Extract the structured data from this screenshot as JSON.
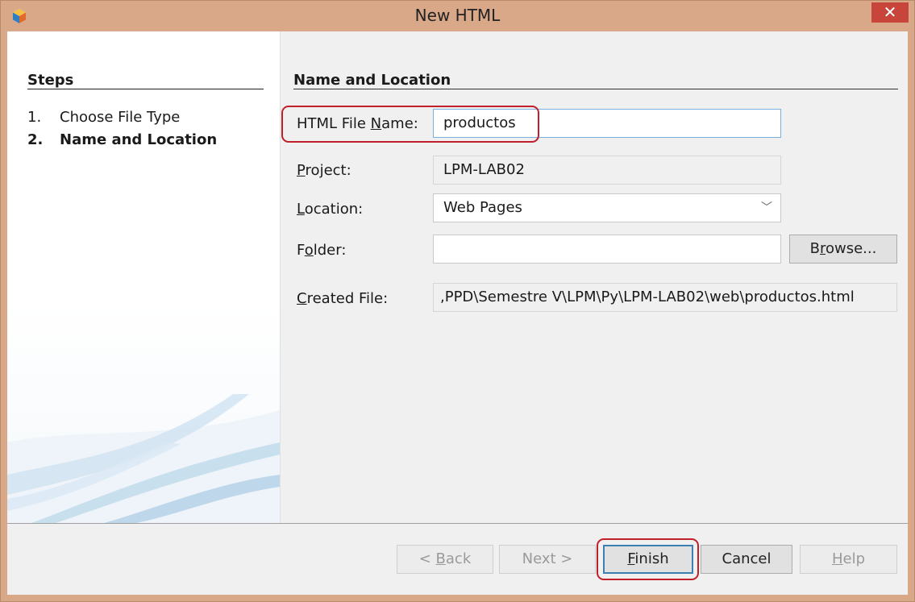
{
  "window": {
    "title": "New HTML",
    "close_glyph": "✕"
  },
  "steps": {
    "heading": "Steps",
    "items": [
      {
        "number": "1.",
        "label": "Choose File Type"
      },
      {
        "number": "2.",
        "label": "Name and Location"
      }
    ]
  },
  "main": {
    "heading": "Name and Location",
    "html_file_name": {
      "label_pre": "HTML File ",
      "label_mnemonic": "N",
      "label_post": "ame:",
      "value": "productos"
    },
    "project": {
      "label_mnemonic": "P",
      "label_post": "roject:",
      "value": "LPM-LAB02"
    },
    "location": {
      "label_mnemonic": "L",
      "label_post": "ocation:",
      "value": "Web Pages"
    },
    "folder": {
      "label_pre": "F",
      "label_mnemonic": "o",
      "label_post": "lder:",
      "value": ""
    },
    "browse": {
      "pre": "B",
      "mnemonic": "r",
      "post": "owse..."
    },
    "created_file": {
      "label_mnemonic": "C",
      "label_post": "reated File:",
      "value": ",PPD\\Semestre V\\LPM\\Py\\LPM-LAB02\\web\\productos.html"
    }
  },
  "buttons": {
    "back": {
      "pre": "< ",
      "mnemonic": "B",
      "post": "ack"
    },
    "next": "Next >",
    "finish": {
      "mnemonic": "F",
      "post": "inish"
    },
    "cancel": "Cancel",
    "help": {
      "mnemonic": "H",
      "post": "elp"
    }
  },
  "colors": {
    "titlebar": "#d9a889",
    "close": "#c7453b",
    "highlight": "#c0202a",
    "focus": "#7ab0e0"
  }
}
